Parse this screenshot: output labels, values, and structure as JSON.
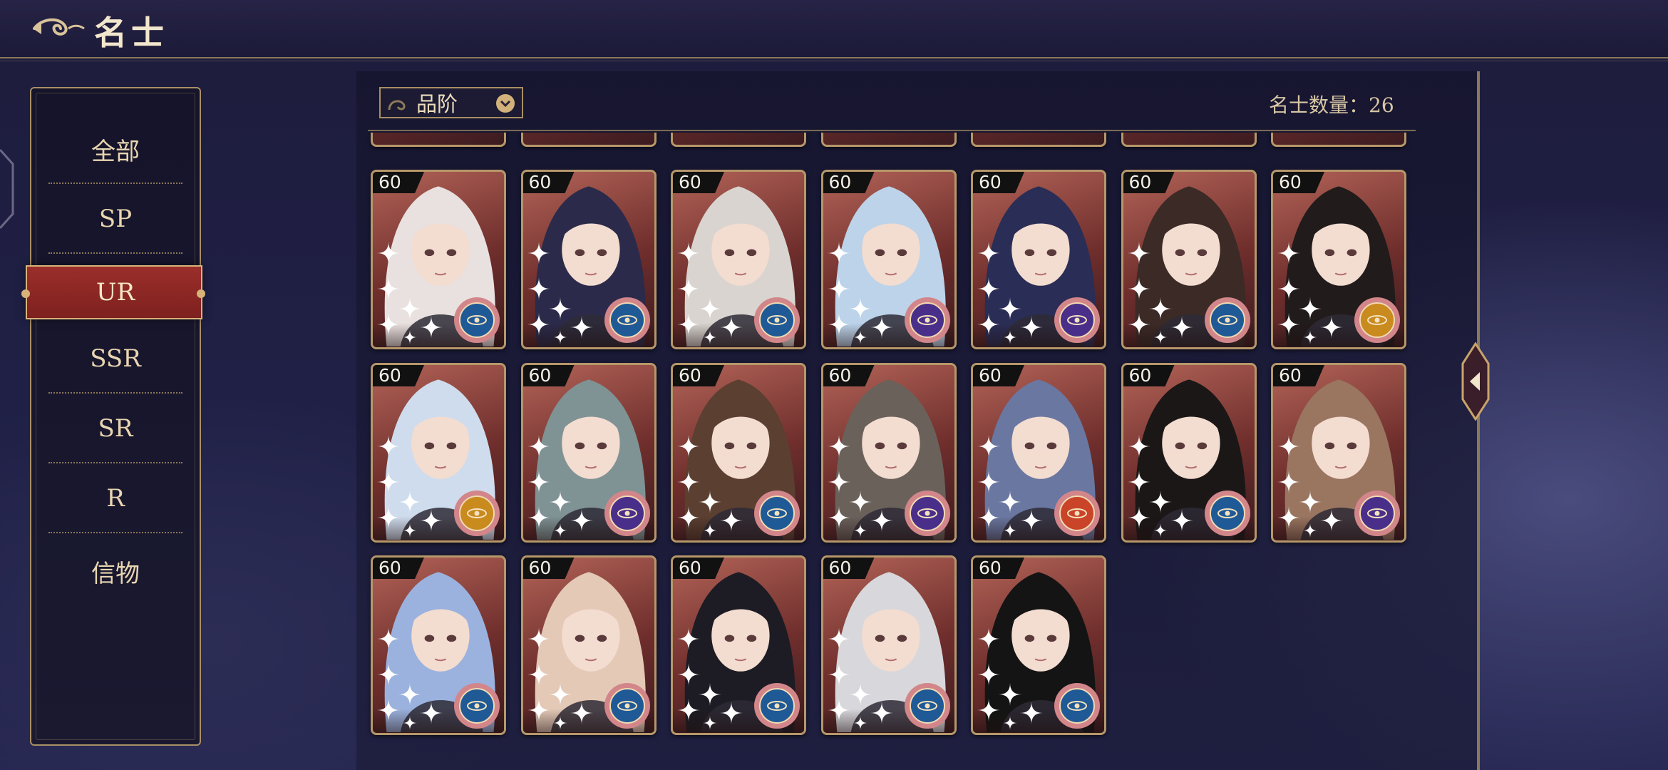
{
  "header": {
    "title": "名士",
    "back_icon": "swirl-back-icon"
  },
  "categories": [
    {
      "label": "全部"
    },
    {
      "label": "SP"
    },
    {
      "label": "UR",
      "selected": true
    },
    {
      "label": "SSR"
    },
    {
      "label": "SR"
    },
    {
      "label": "R"
    },
    {
      "label": "信物"
    }
  ],
  "filter": {
    "dropdown_label": "品阶",
    "dropdown_icon": "chevron-down-icon"
  },
  "count_label": "名士数量：26",
  "colors": {
    "accent_gold": "#b6976a",
    "selected_red": "#9a2e2a",
    "faction_blue": "#1f5a96",
    "faction_purple": "#4a2f8a",
    "faction_gold": "#c98a1e",
    "faction_red": "#c94428"
  },
  "top_row_partial": {
    "count": 7
  },
  "cards": [
    {
      "level": "60",
      "faction": "blue",
      "hair": "#e9e1e0",
      "faction_icon": "eye-emblem-icon"
    },
    {
      "level": "60",
      "faction": "blue",
      "hair": "#2b2a4a",
      "faction_icon": "eye-emblem-icon"
    },
    {
      "level": "60",
      "faction": "blue",
      "hair": "#d9d4cf",
      "faction_icon": "eye-emblem-icon"
    },
    {
      "level": "60",
      "faction": "purple",
      "hair": "#bcd3ea",
      "faction_icon": "planet-emblem-icon"
    },
    {
      "level": "60",
      "faction": "purple",
      "hair": "#2a2d55",
      "faction_icon": "planet-emblem-icon"
    },
    {
      "level": "60",
      "faction": "blue",
      "hair": "#3b2a26",
      "faction_icon": "eye-emblem-icon"
    },
    {
      "level": "60",
      "faction": "gold",
      "hair": "#221b1b",
      "faction_icon": "sun-emblem-icon"
    },
    {
      "level": "60",
      "faction": "gold",
      "hair": "#cfdced",
      "faction_icon": "sun-emblem-icon"
    },
    {
      "level": "60",
      "faction": "purple",
      "hair": "#7f9294",
      "faction_icon": "planet-emblem-icon"
    },
    {
      "level": "60",
      "faction": "blue",
      "hair": "#5b3f31",
      "faction_icon": "eye-emblem-icon"
    },
    {
      "level": "60",
      "faction": "purple",
      "hair": "#6b615b",
      "faction_icon": "planet-emblem-icon"
    },
    {
      "level": "60",
      "faction": "red",
      "hair": "#6a77a0",
      "faction_icon": "fire-emblem-icon"
    },
    {
      "level": "60",
      "faction": "blue",
      "hair": "#1b1717",
      "faction_icon": "eye-emblem-icon"
    },
    {
      "level": "60",
      "faction": "purple",
      "hair": "#9a7560",
      "faction_icon": "planet-emblem-icon"
    },
    {
      "level": "60",
      "faction": "blue",
      "hair": "#9bb2de",
      "faction_icon": "eye-emblem-icon"
    },
    {
      "level": "60",
      "faction": "blue",
      "hair": "#e4c9b7",
      "faction_icon": "eye-emblem-icon"
    },
    {
      "level": "60",
      "faction": "blue",
      "hair": "#1d1c24",
      "faction_icon": "eye-emblem-icon"
    },
    {
      "level": "60",
      "faction": "blue",
      "hair": "#d8d8dc",
      "faction_icon": "eye-emblem-icon"
    },
    {
      "level": "60",
      "faction": "blue",
      "hair": "#141414",
      "faction_icon": "eye-emblem-icon"
    }
  ],
  "side": {
    "collapse_icon": "arrow-left-icon"
  }
}
